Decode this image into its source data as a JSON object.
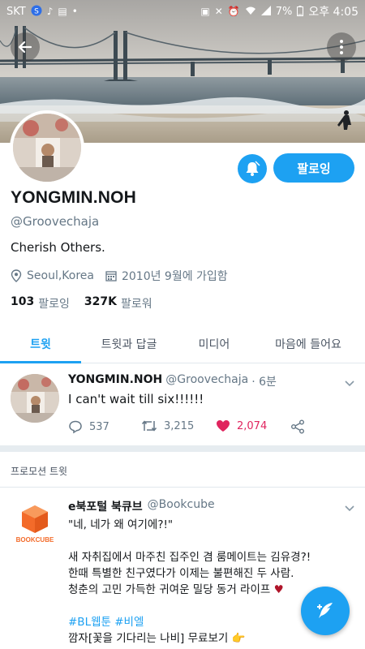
{
  "status_bar": {
    "carrier": "SKT",
    "battery": "7%",
    "time_label": "오후 4:05"
  },
  "header": {
    "back_icon": "arrow-left-icon",
    "more_icon": "vertical-dots-icon"
  },
  "profile": {
    "display_name": "YONGMIN.NOH",
    "handle": "@Groovechaja",
    "bio": "Cherish Others.",
    "location": "Seoul,Korea",
    "joined": "2010년 9월에 가입함",
    "following_count": "103",
    "following_label": "팔로잉",
    "followers_count": "327K",
    "followers_label": "팔로워",
    "follow_button": "팔로잉"
  },
  "tabs": [
    {
      "label": "트윗",
      "active": true
    },
    {
      "label": "트윗과 답글",
      "active": false
    },
    {
      "label": "미디어",
      "active": false
    },
    {
      "label": "마음에 들어요",
      "active": false
    }
  ],
  "tweet": {
    "name": "YONGMIN.NOH",
    "handle": "@Groovechaja",
    "time": "· 6분",
    "text": "I can't wait till six!!!!!!",
    "replies": "537",
    "retweets": "3,215",
    "likes": "2,074"
  },
  "promoted": {
    "section_label": "프로모션 트윗",
    "name": "e북포털 북큐브",
    "handle": "@Bookcube",
    "logo_text": "BOOKCUBE",
    "lines": [
      "\"네, 네가 왜 여기에?!\"",
      "새 자취집에서 마주친 집주인 겸 룸메이트는 김유경?!",
      "한때 특별한 친구였다가 이제는 불편해진 두 사람.",
      "청춘의 고민 가득한 귀여운 밀당 동거 라이프",
      "#BL웹툰 #비엘",
      "깜자[꽃을 기다리는 나비] 무료보기"
    ]
  },
  "colors": {
    "accent": "#1da1f2",
    "like": "#e0245e",
    "secondary_text": "#657786"
  }
}
